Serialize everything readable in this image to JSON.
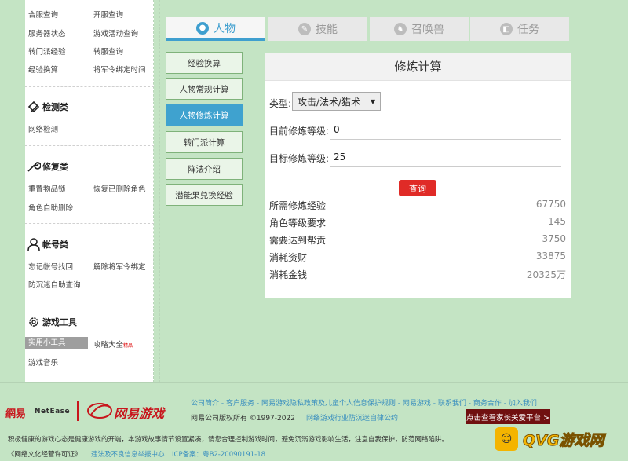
{
  "sidebar": {
    "top_rows": [
      [
        "合服查询",
        "开服查询"
      ],
      [
        "服务器状态",
        "游戏活动查询"
      ],
      [
        "转门派经验",
        "转服查询"
      ],
      [
        "经验换算",
        "将军令绑定时间"
      ]
    ],
    "sections": [
      {
        "title": "检测类",
        "items": [
          "网络检测"
        ]
      },
      {
        "title": "修复类",
        "items": [
          "重置物品锁",
          "恢复已删除角色",
          "角色自助删除"
        ]
      },
      {
        "title": "帐号类",
        "items": [
          "忘记帐号找回",
          "解除将军令绑定",
          "防沉迷自助查询"
        ]
      },
      {
        "title": "游戏工具",
        "items": [
          "实用小工具",
          "攻略大全",
          "游戏音乐"
        ],
        "hot_badge": "精品"
      }
    ]
  },
  "tabs": [
    {
      "label": "人物",
      "icon": "person-icon",
      "active": true
    },
    {
      "label": "技能",
      "icon": "skill-icon",
      "active": false
    },
    {
      "label": "召唤兽",
      "icon": "pet-icon",
      "active": false
    },
    {
      "label": "任务",
      "icon": "task-icon",
      "active": false
    }
  ],
  "calc_menu": [
    "经验换算",
    "人物常规计算",
    "人物修炼计算",
    "转门派计算",
    "阵法介绍",
    "潜能果兑换经验"
  ],
  "panel": {
    "title": "修炼计算",
    "type_label": "类型:",
    "type_value": "攻击/法术/猎术",
    "current_label": "目前修炼等级:",
    "current_value": "0",
    "target_label": "目标修炼等级:",
    "target_value": "25",
    "query_button": "查询",
    "results": [
      {
        "label": "所需修炼经验",
        "value": "67750"
      },
      {
        "label": "角色等级要求",
        "value": "145"
      },
      {
        "label": "需要达到帮贡",
        "value": "3750"
      },
      {
        "label": "消耗资财",
        "value": "33875"
      },
      {
        "label": "消耗金钱",
        "value": "20325万"
      }
    ]
  },
  "footer": {
    "logo1": "網易",
    "logo_en": "NetEase",
    "logo2": "网易游戏",
    "links": "公司简介 - 客户服务 - 网易游戏隐私政策及儿童个人信息保护规则 - 网易游戏 - 联系我们 - 商务合作 - 加入我们",
    "copyright": "网易公司版权所有 ©1997-2022",
    "self_discipline": "网络游戏行业防沉迷自律公约",
    "parent_platform": "点击查看家长关爱平台 >",
    "notice": "积极健康的游戏心态是健康游戏的开端，本游戏故事情节设置紧凑，请您合理控制游戏时间，避免沉溺游戏影响生活，注意自我保护，防范网络陷阱。",
    "license": "《网络文化经营许可证》",
    "report": "违法及不良信息举报中心",
    "icp": "ICP备案：粤B2-20090191-18"
  },
  "watermark": {
    "icon": "game-controller-icon",
    "text": "QVG游戏网"
  },
  "colors": {
    "accent_blue": "#3f9fcf",
    "query_red": "#e02b27",
    "bg_green": "#c4e4c4"
  }
}
